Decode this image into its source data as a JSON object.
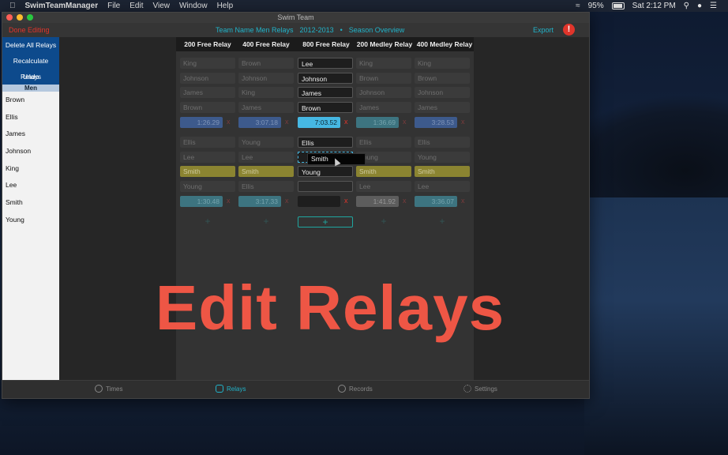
{
  "menubar": {
    "app_name": "SwimTeamManager",
    "menus": [
      "File",
      "Edit",
      "View",
      "Window",
      "Help"
    ],
    "battery": "95%",
    "clock": "Sat 2:12 PM"
  },
  "window": {
    "title": "Swim Team",
    "done_editing": "Done Editing",
    "breadcrumb": [
      "Team Name Men Relays",
      "2012-2013",
      "•",
      "Season Overview"
    ],
    "export": "Export",
    "warning": "!"
  },
  "sidebar": {
    "buttons": [
      "Delete All Relays",
      "Recalculate Relays",
      "Undo"
    ],
    "section": "Men",
    "swimmers": [
      "Brown",
      "Ellis",
      "James",
      "Johnson",
      "King",
      "Lee",
      "Smith",
      "Young"
    ]
  },
  "relays": {
    "headers": [
      "200 Free Relay",
      "400 Free Relay",
      "800 Free Relay",
      "200 Medley Relay",
      "400 Medley Relay"
    ],
    "group1": [
      [
        "King",
        "Johnson",
        "James",
        "Brown"
      ],
      [
        "Brown",
        "Johnson",
        "King",
        "James"
      ],
      [
        "Lee",
        "Johnson",
        "James",
        "Brown"
      ],
      [
        "King",
        "Brown",
        "Johnson",
        "James"
      ],
      [
        "King",
        "Brown",
        "Johnson",
        "James"
      ]
    ],
    "times1": [
      "1:26.29",
      "3:07.18",
      "7:03.52",
      "1:36.69",
      "3:28.53"
    ],
    "group2": [
      [
        "Ellis",
        "Lee",
        "Smith",
        "Young"
      ],
      [
        "Young",
        "Lee",
        "Smith",
        "Ellis"
      ],
      [
        "Ellis",
        "",
        "Young",
        ""
      ],
      [
        "Ellis",
        "Young",
        "Smith",
        "Lee"
      ],
      [
        "Ellis",
        "Young",
        "Smith",
        "Lee"
      ]
    ],
    "times2": [
      "1:30.48",
      "3:17.33",
      "",
      "1:41.92",
      "3:36.07"
    ],
    "x": "x",
    "plus": "+"
  },
  "drag_tooltip": "Smith",
  "tabs": [
    "Times",
    "Relays",
    "Records",
    "Settings"
  ],
  "overlay_caption": "Edit Relays"
}
